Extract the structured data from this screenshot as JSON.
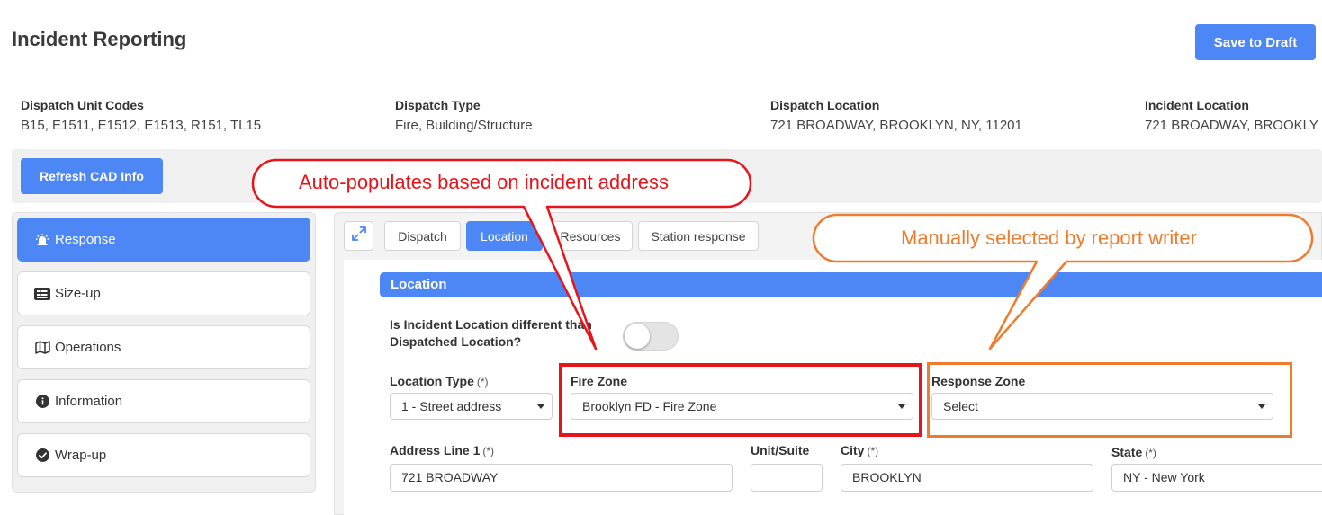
{
  "header": {
    "title": "Incident Reporting",
    "save_label": "Save to Draft"
  },
  "cad_info": [
    {
      "label": "Dispatch Unit Codes",
      "value": "B15, E1511, E1512, E1513, R151, TL15"
    },
    {
      "label": "Dispatch Type",
      "value": "Fire, Building/Structure"
    },
    {
      "label": "Dispatch Location",
      "value": "721 BROADWAY, BROOKLYN, NY, 11201"
    },
    {
      "label": "Incident Location",
      "value": "721 BROADWAY, BROOKLY"
    }
  ],
  "refresh_label": "Refresh CAD Info",
  "sidebar": {
    "items": [
      {
        "label": "Response",
        "icon": "siren-icon",
        "active": true
      },
      {
        "label": "Size-up",
        "icon": "dashboard-icon",
        "active": false
      },
      {
        "label": "Operations",
        "icon": "map-icon",
        "active": false
      },
      {
        "label": "Information",
        "icon": "info-icon",
        "active": false
      },
      {
        "label": "Wrap-up",
        "icon": "check-circle-icon",
        "active": false
      }
    ]
  },
  "tabs": [
    {
      "label": "Dispatch",
      "active": false
    },
    {
      "label": "Location",
      "active": true
    },
    {
      "label": "Resources",
      "active": false
    },
    {
      "label": "Station response",
      "active": false
    }
  ],
  "section": {
    "title": "Location",
    "question": "Is Incident Location different than Dispatched Location?",
    "toggle_on": false
  },
  "fields": {
    "location_type": {
      "label": "Location Type",
      "required": "(*)",
      "value": "1 - Street address"
    },
    "fire_zone": {
      "label": "Fire Zone",
      "value": "Brooklyn FD - Fire Zone"
    },
    "response_zone": {
      "label": "Response Zone",
      "value": "Select"
    },
    "address_line1": {
      "label": "Address Line 1",
      "required": "(*)",
      "value": "721 BROADWAY"
    },
    "unit_suite": {
      "label": "Unit/Suite",
      "value": ""
    },
    "city": {
      "label": "City",
      "required": "(*)",
      "value": "BROOKLYN"
    },
    "state": {
      "label": "State",
      "required": "(*)",
      "value": "NY - New York"
    }
  },
  "annotations": {
    "auto": "Auto-populates based on incident address",
    "manual": "Manually selected by report writer"
  },
  "colors": {
    "accent": "#4d86f5",
    "annotation_red": "#e8141b",
    "annotation_orange": "#ef7c2e"
  }
}
